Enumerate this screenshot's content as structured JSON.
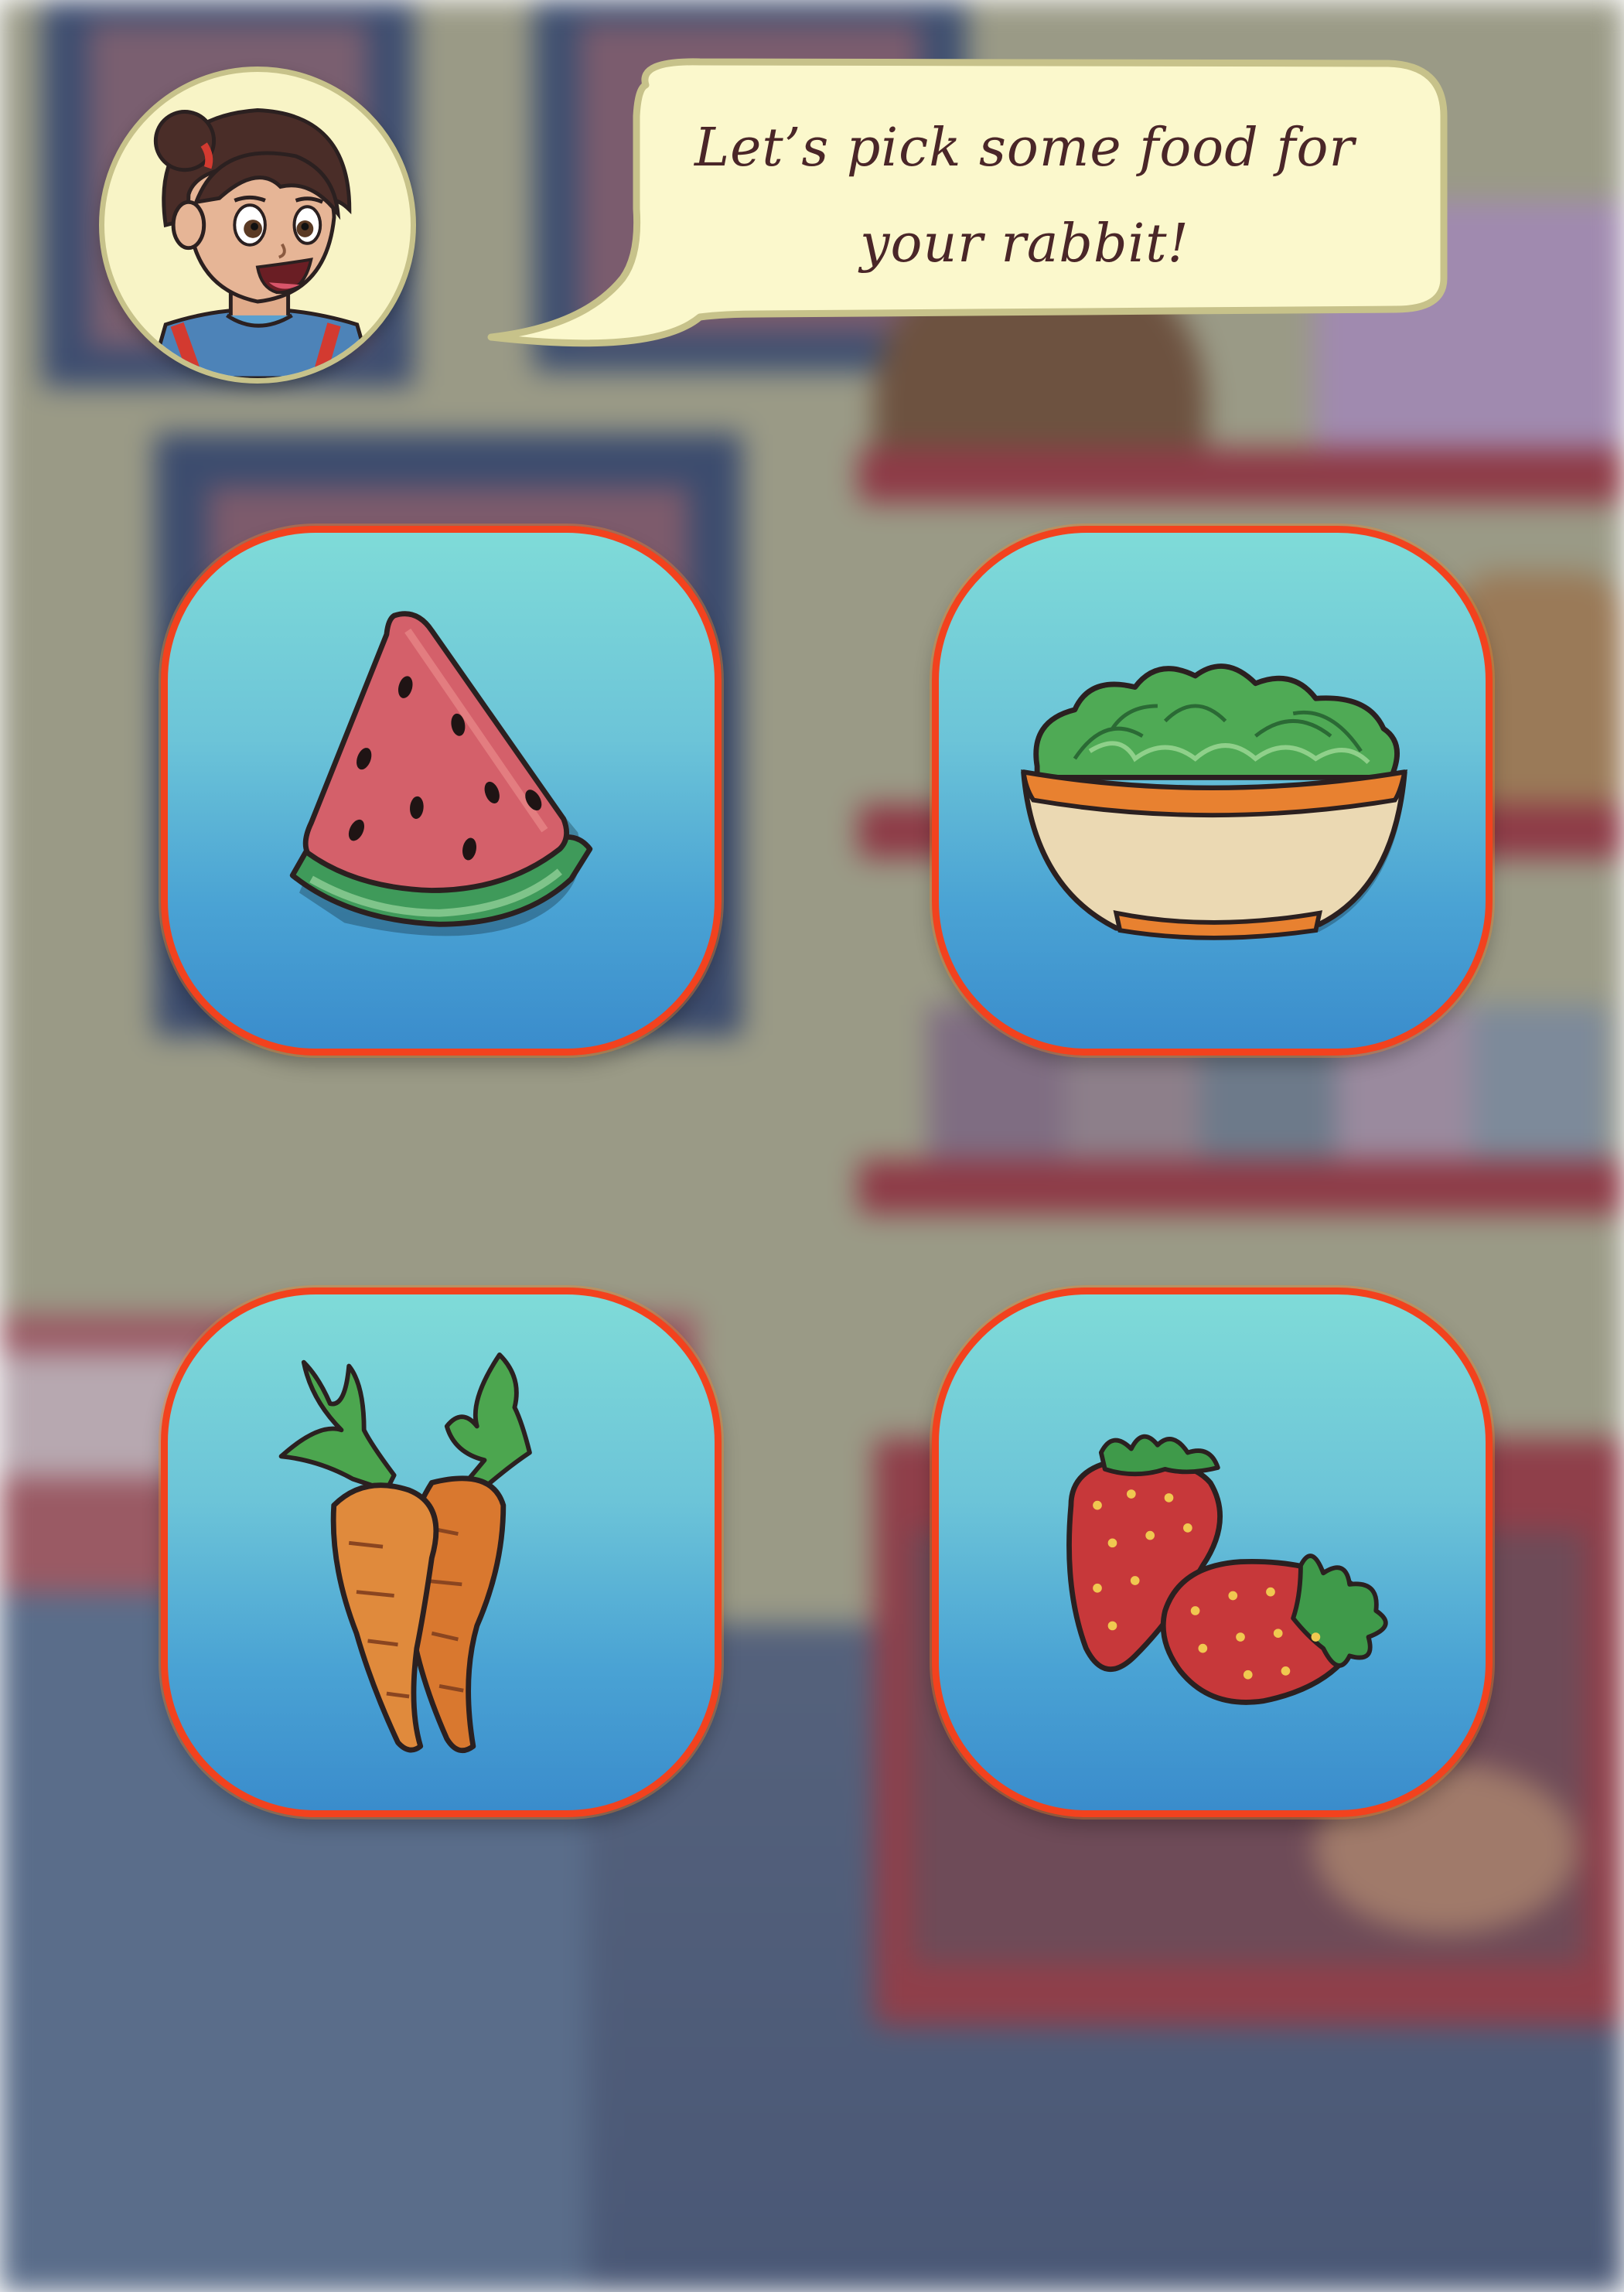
{
  "dialog": {
    "line1": "Let’s pick some food for",
    "line2": "your rabbit!"
  },
  "character": {
    "icon": "girl-avatar-icon"
  },
  "food_options": [
    {
      "id": "watermelon",
      "icon": "watermelon-icon"
    },
    {
      "id": "lettuce",
      "icon": "lettuce-bowl-icon"
    },
    {
      "id": "carrots",
      "icon": "carrots-icon"
    },
    {
      "id": "strawberries",
      "icon": "strawberries-icon"
    }
  ],
  "colors": {
    "card_border": "#f2421e",
    "card_top": "#7fdbd8",
    "card_bottom": "#3a8ccc",
    "bubble_fill": "#fbf8cc",
    "bubble_stroke": "#c7c28a",
    "text": "#4a2628"
  }
}
